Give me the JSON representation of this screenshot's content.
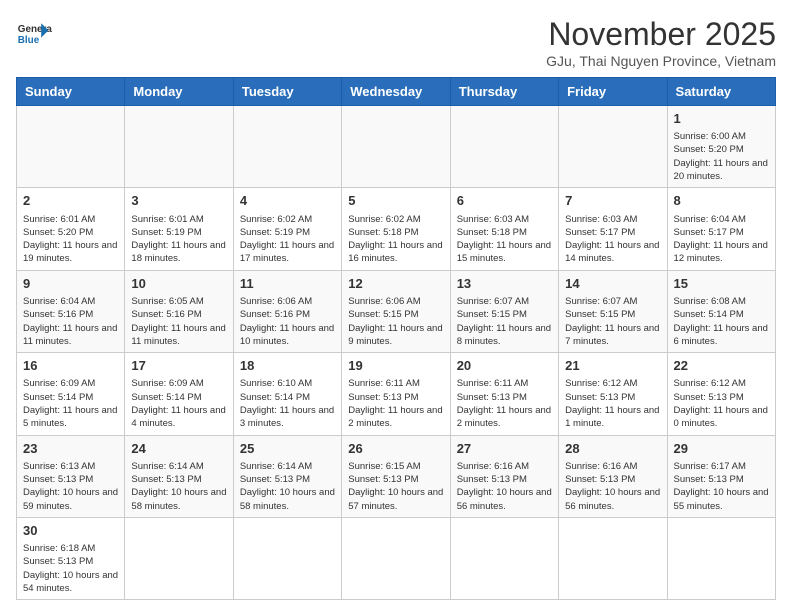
{
  "header": {
    "logo_general": "General",
    "logo_blue": "Blue",
    "month_title": "November 2025",
    "location": "GJu, Thai Nguyen Province, Vietnam"
  },
  "days_of_week": [
    "Sunday",
    "Monday",
    "Tuesday",
    "Wednesday",
    "Thursday",
    "Friday",
    "Saturday"
  ],
  "weeks": [
    [
      {
        "day": "",
        "info": ""
      },
      {
        "day": "",
        "info": ""
      },
      {
        "day": "",
        "info": ""
      },
      {
        "day": "",
        "info": ""
      },
      {
        "day": "",
        "info": ""
      },
      {
        "day": "",
        "info": ""
      },
      {
        "day": "1",
        "info": "Sunrise: 6:00 AM\nSunset: 5:20 PM\nDaylight: 11 hours and 20 minutes."
      }
    ],
    [
      {
        "day": "2",
        "info": "Sunrise: 6:01 AM\nSunset: 5:20 PM\nDaylight: 11 hours and 19 minutes."
      },
      {
        "day": "3",
        "info": "Sunrise: 6:01 AM\nSunset: 5:19 PM\nDaylight: 11 hours and 18 minutes."
      },
      {
        "day": "4",
        "info": "Sunrise: 6:02 AM\nSunset: 5:19 PM\nDaylight: 11 hours and 17 minutes."
      },
      {
        "day": "5",
        "info": "Sunrise: 6:02 AM\nSunset: 5:18 PM\nDaylight: 11 hours and 16 minutes."
      },
      {
        "day": "6",
        "info": "Sunrise: 6:03 AM\nSunset: 5:18 PM\nDaylight: 11 hours and 15 minutes."
      },
      {
        "day": "7",
        "info": "Sunrise: 6:03 AM\nSunset: 5:17 PM\nDaylight: 11 hours and 14 minutes."
      },
      {
        "day": "8",
        "info": "Sunrise: 6:04 AM\nSunset: 5:17 PM\nDaylight: 11 hours and 12 minutes."
      }
    ],
    [
      {
        "day": "9",
        "info": "Sunrise: 6:04 AM\nSunset: 5:16 PM\nDaylight: 11 hours and 11 minutes."
      },
      {
        "day": "10",
        "info": "Sunrise: 6:05 AM\nSunset: 5:16 PM\nDaylight: 11 hours and 11 minutes."
      },
      {
        "day": "11",
        "info": "Sunrise: 6:06 AM\nSunset: 5:16 PM\nDaylight: 11 hours and 10 minutes."
      },
      {
        "day": "12",
        "info": "Sunrise: 6:06 AM\nSunset: 5:15 PM\nDaylight: 11 hours and 9 minutes."
      },
      {
        "day": "13",
        "info": "Sunrise: 6:07 AM\nSunset: 5:15 PM\nDaylight: 11 hours and 8 minutes."
      },
      {
        "day": "14",
        "info": "Sunrise: 6:07 AM\nSunset: 5:15 PM\nDaylight: 11 hours and 7 minutes."
      },
      {
        "day": "15",
        "info": "Sunrise: 6:08 AM\nSunset: 5:14 PM\nDaylight: 11 hours and 6 minutes."
      }
    ],
    [
      {
        "day": "16",
        "info": "Sunrise: 6:09 AM\nSunset: 5:14 PM\nDaylight: 11 hours and 5 minutes."
      },
      {
        "day": "17",
        "info": "Sunrise: 6:09 AM\nSunset: 5:14 PM\nDaylight: 11 hours and 4 minutes."
      },
      {
        "day": "18",
        "info": "Sunrise: 6:10 AM\nSunset: 5:14 PM\nDaylight: 11 hours and 3 minutes."
      },
      {
        "day": "19",
        "info": "Sunrise: 6:11 AM\nSunset: 5:13 PM\nDaylight: 11 hours and 2 minutes."
      },
      {
        "day": "20",
        "info": "Sunrise: 6:11 AM\nSunset: 5:13 PM\nDaylight: 11 hours and 2 minutes."
      },
      {
        "day": "21",
        "info": "Sunrise: 6:12 AM\nSunset: 5:13 PM\nDaylight: 11 hours and 1 minute."
      },
      {
        "day": "22",
        "info": "Sunrise: 6:12 AM\nSunset: 5:13 PM\nDaylight: 11 hours and 0 minutes."
      }
    ],
    [
      {
        "day": "23",
        "info": "Sunrise: 6:13 AM\nSunset: 5:13 PM\nDaylight: 10 hours and 59 minutes."
      },
      {
        "day": "24",
        "info": "Sunrise: 6:14 AM\nSunset: 5:13 PM\nDaylight: 10 hours and 58 minutes."
      },
      {
        "day": "25",
        "info": "Sunrise: 6:14 AM\nSunset: 5:13 PM\nDaylight: 10 hours and 58 minutes."
      },
      {
        "day": "26",
        "info": "Sunrise: 6:15 AM\nSunset: 5:13 PM\nDaylight: 10 hours and 57 minutes."
      },
      {
        "day": "27",
        "info": "Sunrise: 6:16 AM\nSunset: 5:13 PM\nDaylight: 10 hours and 56 minutes."
      },
      {
        "day": "28",
        "info": "Sunrise: 6:16 AM\nSunset: 5:13 PM\nDaylight: 10 hours and 56 minutes."
      },
      {
        "day": "29",
        "info": "Sunrise: 6:17 AM\nSunset: 5:13 PM\nDaylight: 10 hours and 55 minutes."
      }
    ],
    [
      {
        "day": "30",
        "info": "Sunrise: 6:18 AM\nSunset: 5:13 PM\nDaylight: 10 hours and 54 minutes."
      },
      {
        "day": "",
        "info": ""
      },
      {
        "day": "",
        "info": ""
      },
      {
        "day": "",
        "info": ""
      },
      {
        "day": "",
        "info": ""
      },
      {
        "day": "",
        "info": ""
      },
      {
        "day": "",
        "info": ""
      }
    ]
  ]
}
